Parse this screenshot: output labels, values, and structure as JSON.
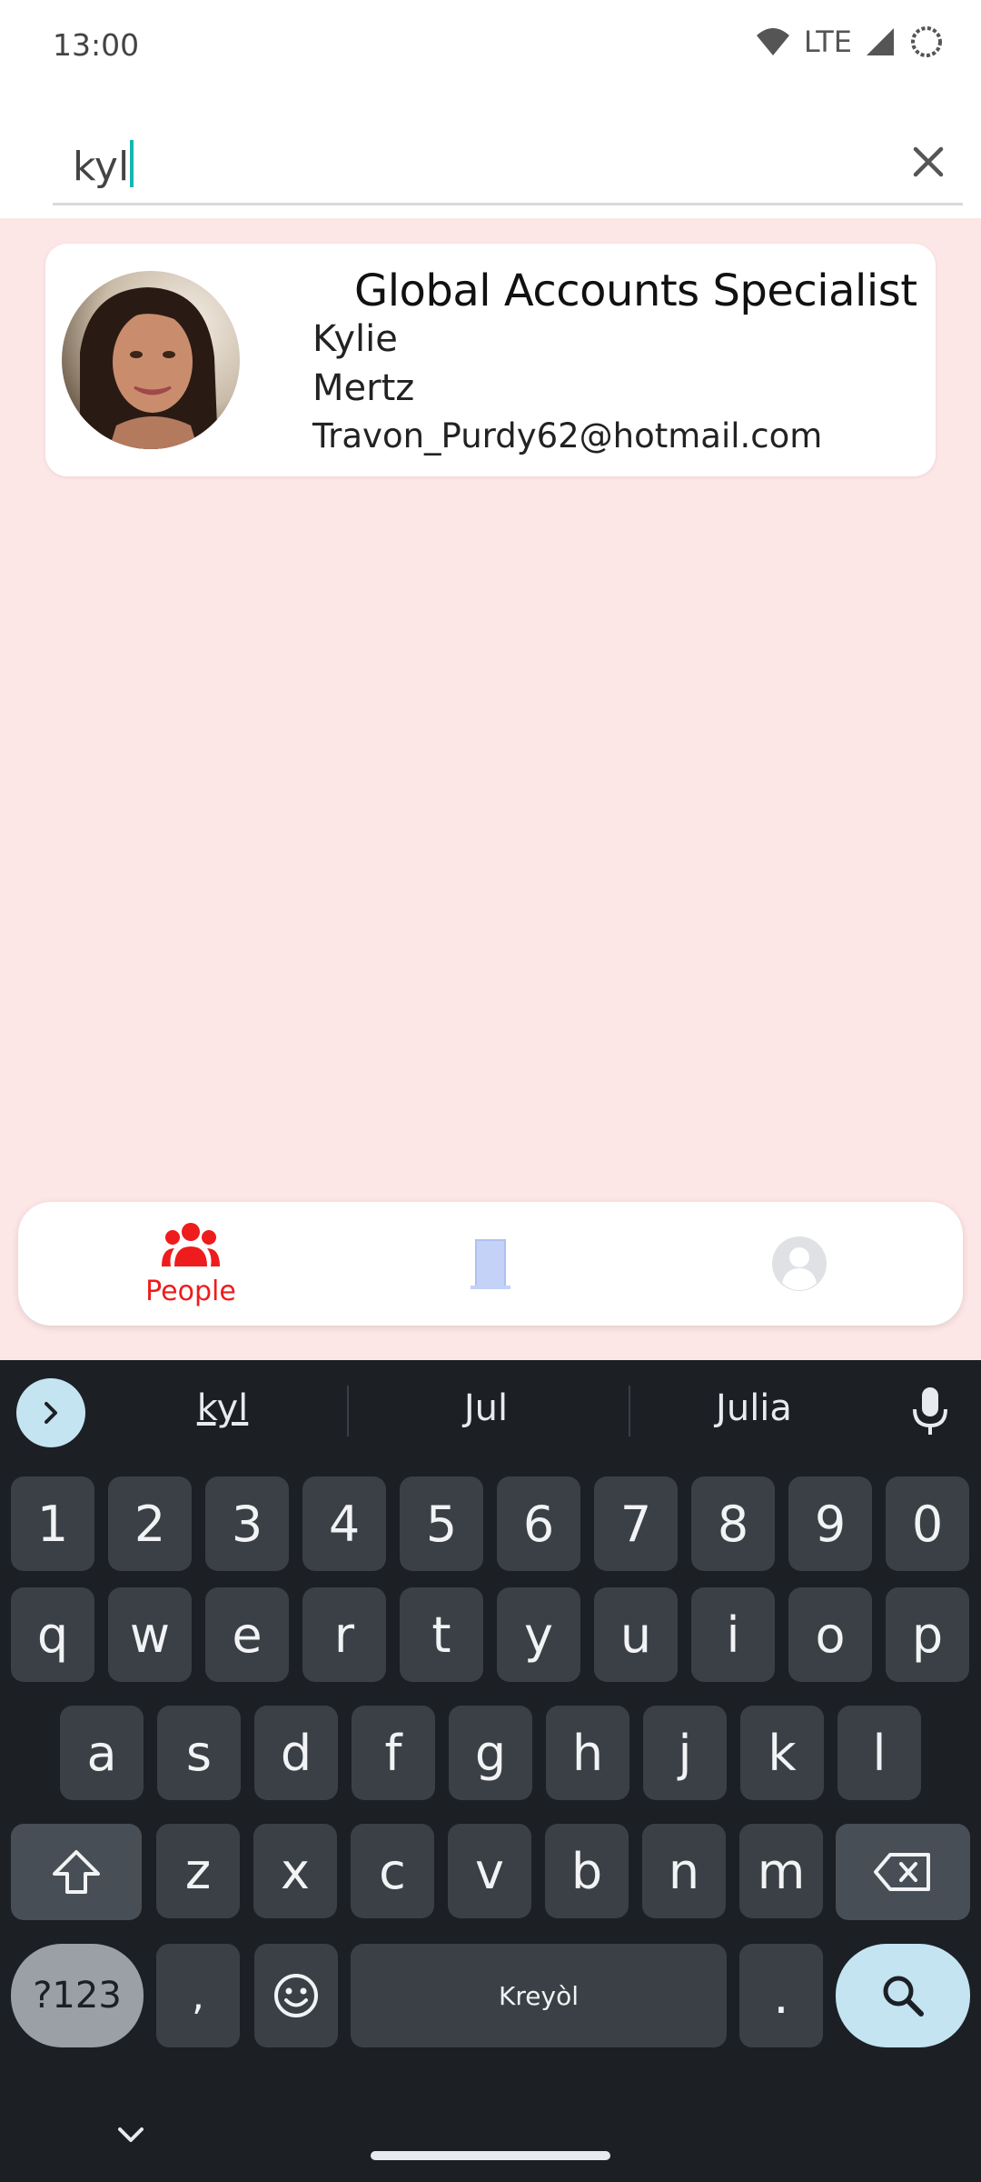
{
  "status_bar": {
    "time": "13:00",
    "network": "LTE"
  },
  "search": {
    "query": "kyl"
  },
  "results": [
    {
      "title": "Global Accounts Specialist",
      "first_name": "Kylie",
      "last_name": "Mertz",
      "email": "Travon_Purdy62@hotmail.com"
    }
  ],
  "bottom_nav": {
    "items": [
      {
        "label": "People",
        "icon": "people-icon",
        "active": true
      },
      {
        "label": "",
        "icon": "door-icon",
        "active": false
      },
      {
        "label": "",
        "icon": "profile-icon",
        "active": false
      }
    ]
  },
  "keyboard": {
    "suggestions": [
      "kyl",
      "Jul",
      "Julia"
    ],
    "row_numbers": [
      "1",
      "2",
      "3",
      "4",
      "5",
      "6",
      "7",
      "8",
      "9",
      "0"
    ],
    "row_1": [
      "q",
      "w",
      "e",
      "r",
      "t",
      "y",
      "u",
      "i",
      "o",
      "p"
    ],
    "row_2": [
      "a",
      "s",
      "d",
      "f",
      "g",
      "h",
      "j",
      "k",
      "l"
    ],
    "row_3": [
      "z",
      "x",
      "c",
      "v",
      "b",
      "n",
      "m"
    ],
    "symbols_key": "?123",
    "comma_key": ",",
    "space_label": "Kreyòl",
    "period_key": "."
  },
  "colors": {
    "accent_red": "#ee1c1c",
    "content_bg": "#fde6e6",
    "cursor": "#17b7b2",
    "keyboard_bg": "#1c2025",
    "key_bg": "#3b4046",
    "action_key": "#c4e4f2"
  }
}
